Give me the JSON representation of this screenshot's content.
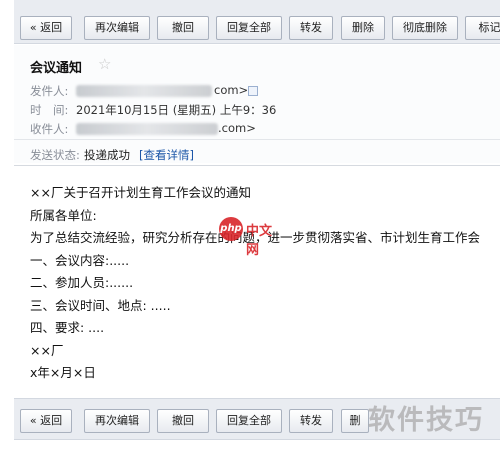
{
  "toolbar_top": {
    "buttons": [
      "« 返回",
      "再次编辑",
      "撤回",
      "回复全部",
      "转发",
      "删除",
      "彻底删除",
      "标记为"
    ]
  },
  "toolbar_bottom": {
    "buttons": [
      "« 返回",
      "再次编辑",
      "撤回",
      "回复全部",
      "转发",
      "删"
    ]
  },
  "mail": {
    "subject": "会议通知",
    "star": "☆",
    "from_label": "发件人:",
    "from_suffix": "com>",
    "time_label": "时　间:",
    "time_value": "2021年10月15日 (星期五) 上午9：36",
    "to_label": "收件人:",
    "to_suffix": ".com>",
    "status_label": "发送状态:",
    "status_value": "投递成功",
    "status_link": "[查看详情]"
  },
  "body_lines": [
    "××厂关于召开计划生育工作会议的通知",
    "所属各单位:",
    "为了总结交流经验，研究分析存在的问题，进一步贯彻落实省、市计划生育工作会",
    "一、会议内容:.....",
    "二、参加人员:......",
    "三、会议时间、地点: .....",
    "四、要求: ....",
    "××厂",
    "x年×月×日"
  ],
  "watermarks": {
    "php_logo": "php",
    "php_text": "中文网",
    "bottom_text": "软件技巧"
  }
}
